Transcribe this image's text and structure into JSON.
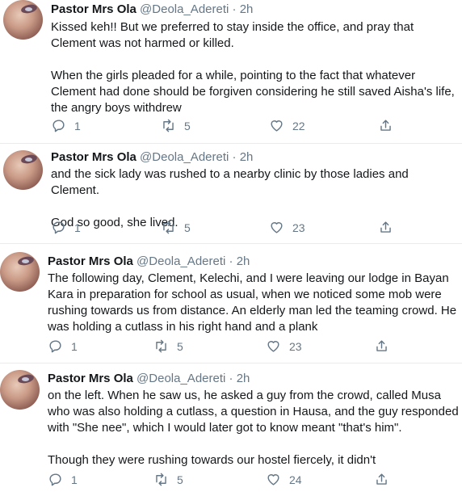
{
  "tweets": [
    {
      "name": "Pastor Mrs Ola",
      "handle": "@Deola_Adereti",
      "sep": "·",
      "time": "2h",
      "paragraphs": [
        "Kissed keh!! But we preferred to stay inside the office, and pray that Clement was not harmed or killed.",
        "When the girls pleaded for a while, pointing to the fact that whatever Clement had done should be forgiven considering he still saved Aisha's life, the angry boys withdrew"
      ],
      "replies": "1",
      "retweets": "5",
      "likes": "22"
    },
    {
      "name": "Pastor Mrs Ola",
      "handle": "@Deola_Adereti",
      "sep": "·",
      "time": "2h",
      "paragraphs": [
        "and the sick lady was rushed to a nearby clinic by those ladies and Clement.",
        "God so good, she lived."
      ],
      "replies": "1",
      "retweets": "5",
      "likes": "23"
    },
    {
      "name": "Pastor Mrs Ola",
      "handle": "@Deola_Adereti",
      "sep": "·",
      "time": "2h",
      "paragraphs": [
        "The following day, Clement, Kelechi, and I were leaving our lodge in Bayan Kara in preparation for school as usual, when we noticed some mob were rushing towards us from distance. An elderly man led the teaming crowd. He was holding a cutlass in his right hand and a plank"
      ],
      "replies": "1",
      "retweets": "5",
      "likes": "23"
    },
    {
      "name": "Pastor Mrs Ola",
      "handle": "@Deola_Adereti",
      "sep": "·",
      "time": "2h",
      "paragraphs": [
        "on the left. When he saw us, he asked a guy from the crowd, called Musa who was also holding a cutlass, a question in Hausa, and the guy responded with \"She nee\", which I would later got to know meant \"that's him\".",
        "Though they were rushing towards our hostel fiercely, it didn't"
      ],
      "replies": "1",
      "retweets": "5",
      "likes": "24"
    }
  ],
  "icons": {
    "reply": "reply-icon",
    "retweet": "retweet-icon",
    "like": "heart-icon",
    "share": "share-icon"
  },
  "colors": {
    "text": "#14171a",
    "secondary": "#657786",
    "divider": "#e6ecf0"
  }
}
